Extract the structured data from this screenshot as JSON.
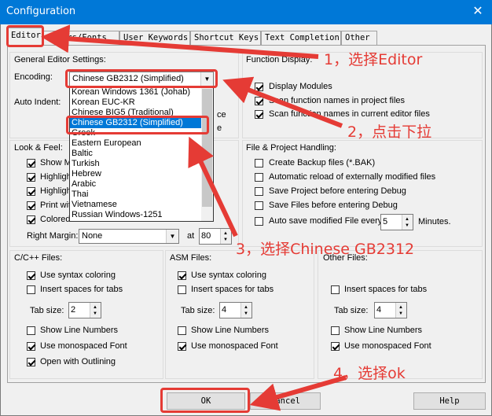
{
  "window": {
    "title": "Configuration",
    "close_glyph": "✕"
  },
  "tabs": [
    "Editor",
    "Colors/Fonts",
    "User Keywords",
    "Shortcut Keys",
    "Text Completion",
    "Other"
  ],
  "general": {
    "header": "General Editor Settings:",
    "encoding_label": "Encoding:",
    "encoding_value": "Chinese GB2312 (Simplified)",
    "auto_indent_label": "Auto Indent:",
    "encoding_options": [
      "Korean Windows 1361 (Johab)",
      "Korean EUC-KR",
      "Chinese BIG5 (Traditional)",
      "Chinese GB2312 (Simplified)",
      "Greek",
      "Eastern European",
      "Baltic",
      "Turkish",
      "Hebrew",
      "Arabic",
      "Thai",
      "Vietnamese",
      "Russian Windows-1251"
    ],
    "partial_right": [
      "ce",
      "e"
    ]
  },
  "function_display": {
    "header": "Function Display:",
    "items": [
      {
        "label": "Display Modules",
        "checked": true
      },
      {
        "label": "Scan function names in project files",
        "checked": true
      },
      {
        "label": "Scan function names in current editor files",
        "checked": true
      }
    ]
  },
  "look_feel": {
    "header": "Look & Feel:",
    "items": [
      {
        "label": "Show M",
        "checked": true
      },
      {
        "label": "Highligh",
        "checked": true
      },
      {
        "label": "Highligh",
        "checked": true
      },
      {
        "label": "Print wit",
        "checked": true
      },
      {
        "label": "Colored Editor Tabs",
        "checked": true
      }
    ],
    "right_margin_label": "Right Margin:",
    "right_margin_value": "None",
    "at_label": "at",
    "at_value": "80"
  },
  "file_project": {
    "header": "File & Project Handling:",
    "items": [
      {
        "label": "Create Backup files (*.BAK)",
        "checked": false
      },
      {
        "label": "Automatic reload of externally modified files",
        "checked": false
      },
      {
        "label": "Save Project before entering Debug",
        "checked": false
      },
      {
        "label": "Save Files before entering Debug",
        "checked": false
      }
    ],
    "autosave_label": "Auto save modified File every",
    "autosave_value": "5",
    "minutes_label": "Minutes."
  },
  "cfiles": {
    "header": "C/C++ Files:",
    "syntax": "Use syntax coloring",
    "spaces": "Insert spaces for tabs",
    "tabsize_label": "Tab size:",
    "tabsize_value": "2",
    "line_numbers": "Show Line Numbers",
    "monospaced": "Use monospaced Font",
    "outlining": "Open with Outlining"
  },
  "asmfiles": {
    "header": "ASM Files:",
    "syntax": "Use syntax coloring",
    "spaces": "Insert spaces for tabs",
    "tabsize_label": "Tab size:",
    "tabsize_value": "4",
    "line_numbers": "Show Line Numbers",
    "monospaced": "Use monospaced Font"
  },
  "otherfiles": {
    "header": "Other Files:",
    "spaces": "Insert spaces for tabs",
    "tabsize_label": "Tab size:",
    "tabsize_value": "4",
    "line_numbers": "Show Line Numbers",
    "monospaced": "Use monospaced Font"
  },
  "buttons": {
    "ok": "OK",
    "cancel": "Cancel",
    "help": "Help"
  },
  "annotations": {
    "step1": "1，选择Editor",
    "step2": "2，点击下拉",
    "step3": "3，选择Chinese GB2312",
    "step4": "4，选择ok",
    "color": "#e53b35"
  }
}
